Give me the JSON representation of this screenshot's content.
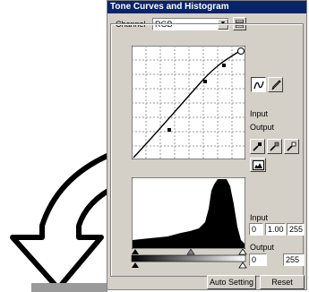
{
  "window": {
    "title": "Tone Curves and Histogram"
  },
  "channel": {
    "label": "Channel",
    "selected": "RGB"
  },
  "curve_panel": {
    "input_label": "Input",
    "output_label": "Output"
  },
  "histogram_panel": {
    "input_label": "Input",
    "input_black": "0",
    "input_gamma": "1.00",
    "input_white": "255",
    "output_label": "Output",
    "output_black": "0",
    "output_white": "255"
  },
  "footer": {
    "auto_setting_label": "Auto Setting",
    "reset_label": "Reset"
  },
  "icons": {
    "curve_tool": "curve-tool-icon",
    "pencil_tool": "pencil-tool-icon",
    "eyedroppers": [
      "black-eyedropper-icon",
      "gray-eyedropper-icon",
      "white-eyedropper-icon"
    ]
  }
}
